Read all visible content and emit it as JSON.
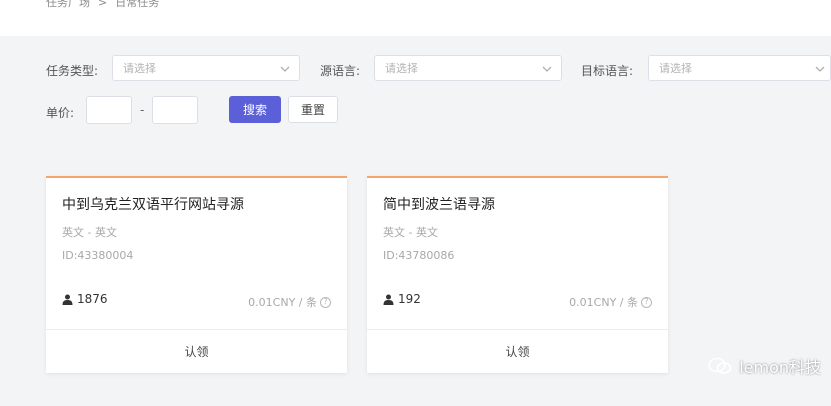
{
  "breadcrumb": {
    "items": [
      "任务广场",
      "日常任务"
    ],
    "separator": ">"
  },
  "filters": {
    "task_type": {
      "label": "任务类型:",
      "placeholder": "请选择"
    },
    "source_lang": {
      "label": "源语言:",
      "placeholder": "请选择"
    },
    "target_lang": {
      "label": "目标语言:",
      "placeholder": "请选择"
    },
    "price": {
      "label": "单价:",
      "separator": "-",
      "min": "",
      "max": ""
    },
    "search_label": "搜索",
    "reset_label": "重置"
  },
  "cards": [
    {
      "title": "中到乌克兰双语平行网站寻源",
      "lang": "英文 - 英文",
      "id": "ID:43380004",
      "count": "1876",
      "price": "0.01CNY / 条",
      "claim_label": "认领"
    },
    {
      "title": "简中到波兰语寻源",
      "lang": "英文 - 英文",
      "id": "ID:43780086",
      "count": "192",
      "price": "0.01CNY / 条",
      "claim_label": "认领"
    }
  ],
  "watermark": {
    "text": "lemon科技"
  },
  "colors": {
    "primary": "#5b5fd8",
    "card_accent": "#f3a56e",
    "background": "#f3f4f6"
  },
  "icons": {
    "chevron": "chevron-down-icon",
    "user": "user-icon",
    "help": "help-circle-icon",
    "wechat": "wechat-icon"
  }
}
